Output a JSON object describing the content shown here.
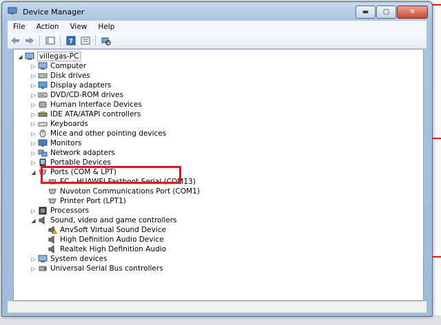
{
  "window": {
    "title": "Device Manager",
    "buttons": {
      "minimize": "▬",
      "maximize": "▢",
      "close": "✕"
    }
  },
  "menu": [
    "File",
    "Action",
    "View",
    "Help"
  ],
  "toolbar": [
    "back-icon",
    "forward-icon",
    "show-hide-tree-icon",
    "help-icon",
    "properties-icon",
    "scan-hardware-icon"
  ],
  "tree": {
    "root": "villegas-PC",
    "categories": [
      {
        "label": "Computer",
        "icon": "computer-icon"
      },
      {
        "label": "Disk drives",
        "icon": "disk-drive-icon"
      },
      {
        "label": "Display adapters",
        "icon": "display-adapter-icon"
      },
      {
        "label": "DVD/CD-ROM drives",
        "icon": "dvd-drive-icon"
      },
      {
        "label": "Human Interface Devices",
        "icon": "hid-icon"
      },
      {
        "label": "IDE ATA/ATAPI controllers",
        "icon": "ide-controller-icon"
      },
      {
        "label": "Keyboards",
        "icon": "keyboard-icon"
      },
      {
        "label": "Mice and other pointing devices",
        "icon": "mouse-icon"
      },
      {
        "label": "Monitors",
        "icon": "monitor-icon"
      },
      {
        "label": "Network adapters",
        "icon": "network-adapter-icon"
      },
      {
        "label": "Portable Devices",
        "icon": "portable-device-icon"
      },
      {
        "label": "Ports (COM & LPT)",
        "icon": "port-icon",
        "expanded": true
      },
      {
        "label": "FC - HUAWEI Fastboot Serial (COM13)",
        "icon": "port-icon",
        "child": true
      },
      {
        "label": "Nuvoton Communications Port (COM1)",
        "icon": "port-icon",
        "child": true
      },
      {
        "label": "Printer Port (LPT1)",
        "icon": "port-icon",
        "child": true
      },
      {
        "label": "Processors",
        "icon": "processor-icon"
      },
      {
        "label": "Sound, video and game controllers",
        "icon": "sound-icon",
        "expanded": true
      },
      {
        "label": "AnvSoft Virtual Sound Device",
        "icon": "warning-device-icon",
        "child": true
      },
      {
        "label": "High Definition Audio Device",
        "icon": "audio-device-icon",
        "child": true
      },
      {
        "label": "Realtek High Definition Audio",
        "icon": "audio-device-icon",
        "child": true
      },
      {
        "label": "System devices",
        "icon": "system-device-icon"
      },
      {
        "label": "Universal Serial Bus controllers",
        "icon": "usb-icon"
      }
    ]
  }
}
